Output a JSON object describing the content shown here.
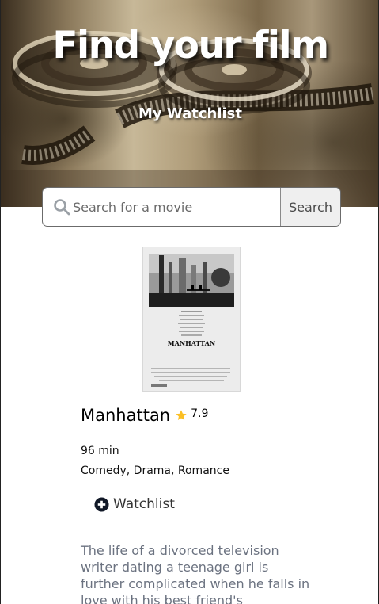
{
  "header": {
    "title": "Find your film",
    "watchlist_link": "My Watchlist"
  },
  "search": {
    "placeholder": "Search for a movie",
    "value": "",
    "button_label": "Search",
    "icon": "search-icon"
  },
  "movie": {
    "poster_text": "MANHATTAN",
    "title": "Manhattan",
    "rating_icon": "star-icon",
    "rating": "7.9",
    "runtime": "96 min",
    "genres": "Comedy, Drama, Romance",
    "watchlist_icon": "plus-circle-icon",
    "watchlist_label": "Watchlist",
    "plot": "The life of a divorced television writer dating a teenage girl is further complicated when he falls in love with his best friend's"
  },
  "colors": {
    "star": "#fbbf24",
    "plot_text": "#6b7280",
    "watchlist_icon": "#111827"
  }
}
